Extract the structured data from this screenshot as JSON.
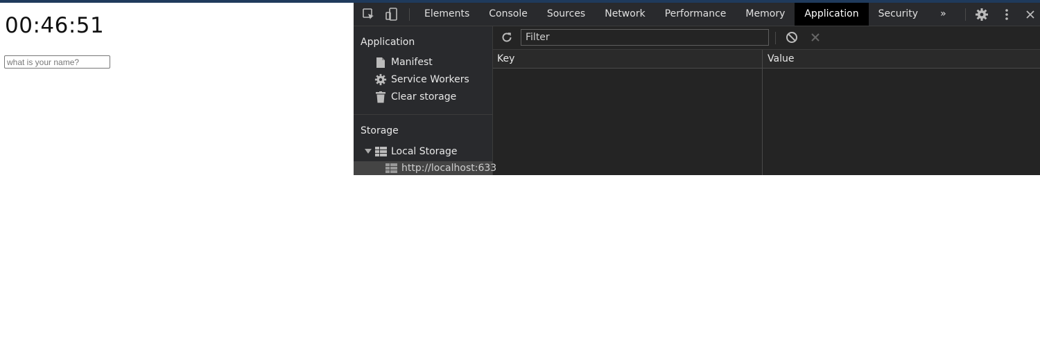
{
  "page": {
    "clock": "00:46:51",
    "name_placeholder": "what is your name?"
  },
  "devtools": {
    "toolbar_icons": [
      "inspect-element-icon",
      "device-toolbar-icon",
      "more-tabs-icon",
      "settings-gear-icon",
      "kebab-menu-icon",
      "close-icon"
    ],
    "tabs": [
      "Elements",
      "Console",
      "Sources",
      "Network",
      "Performance",
      "Memory",
      "Application",
      "Security"
    ],
    "active_tab": "Application",
    "more_tabs": "»",
    "sidebar": {
      "application_heading": "Application",
      "application_items": [
        {
          "label": "Manifest",
          "icon": "file-icon"
        },
        {
          "label": "Service Workers",
          "icon": "gear-icon"
        },
        {
          "label": "Clear storage",
          "icon": "trash-icon"
        }
      ],
      "storage_heading": "Storage",
      "local_storage": {
        "label": "Local Storage",
        "icon": "table-icon",
        "expanded": true
      },
      "local_storage_origin": "http://localhost:633"
    },
    "filter_placeholder": "Filter",
    "table": {
      "columns": [
        "Key",
        "Value"
      ],
      "rows": []
    },
    "colors": {
      "panel_bg": "#242424",
      "toolbar_bg": "#292a2d",
      "active_tab_bg": "#000000",
      "text": "#e8e8e8"
    }
  }
}
